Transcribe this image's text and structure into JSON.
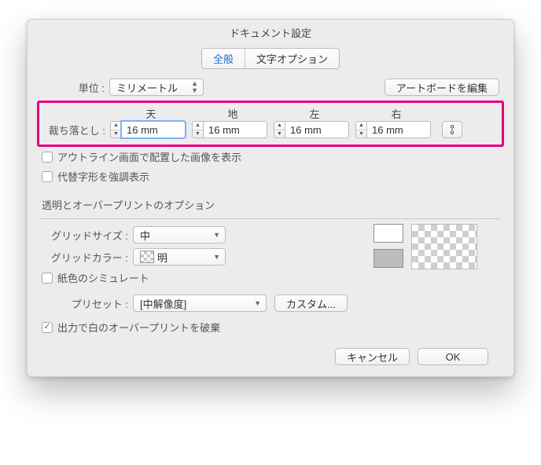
{
  "title": "ドキュメント設定",
  "tabs": {
    "general": "全般",
    "type": "文字オプション"
  },
  "units": {
    "label": "単位 :",
    "value": "ミリメートル"
  },
  "editArtboards": "アートボードを編集",
  "bleed": {
    "label": "裁ち落とし :",
    "headers": {
      "top": "天",
      "bottom": "地",
      "left": "左",
      "right": "右"
    },
    "values": {
      "top": "16 mm",
      "bottom": "16 mm",
      "left": "16 mm",
      "right": "16 mm"
    }
  },
  "checks": {
    "outline": "アウトライン画面で配置した画像を表示",
    "altglyph": "代替字形を強調表示",
    "simulatePaper": "紙色のシミュレート",
    "discardWhiteOP": "出力で白のオーバープリントを破棄"
  },
  "transparency": {
    "section": "透明とオーバープリントのオプション",
    "gridSizeLabel": "グリッドサイズ :",
    "gridSizeValue": "中",
    "gridColorLabel": "グリッドカラー :",
    "gridColorValue": "明",
    "presetLabel": "プリセット :",
    "presetValue": "[中解像度]",
    "customBtn": "カスタム..."
  },
  "footer": {
    "cancel": "キャンセル",
    "ok": "OK"
  }
}
